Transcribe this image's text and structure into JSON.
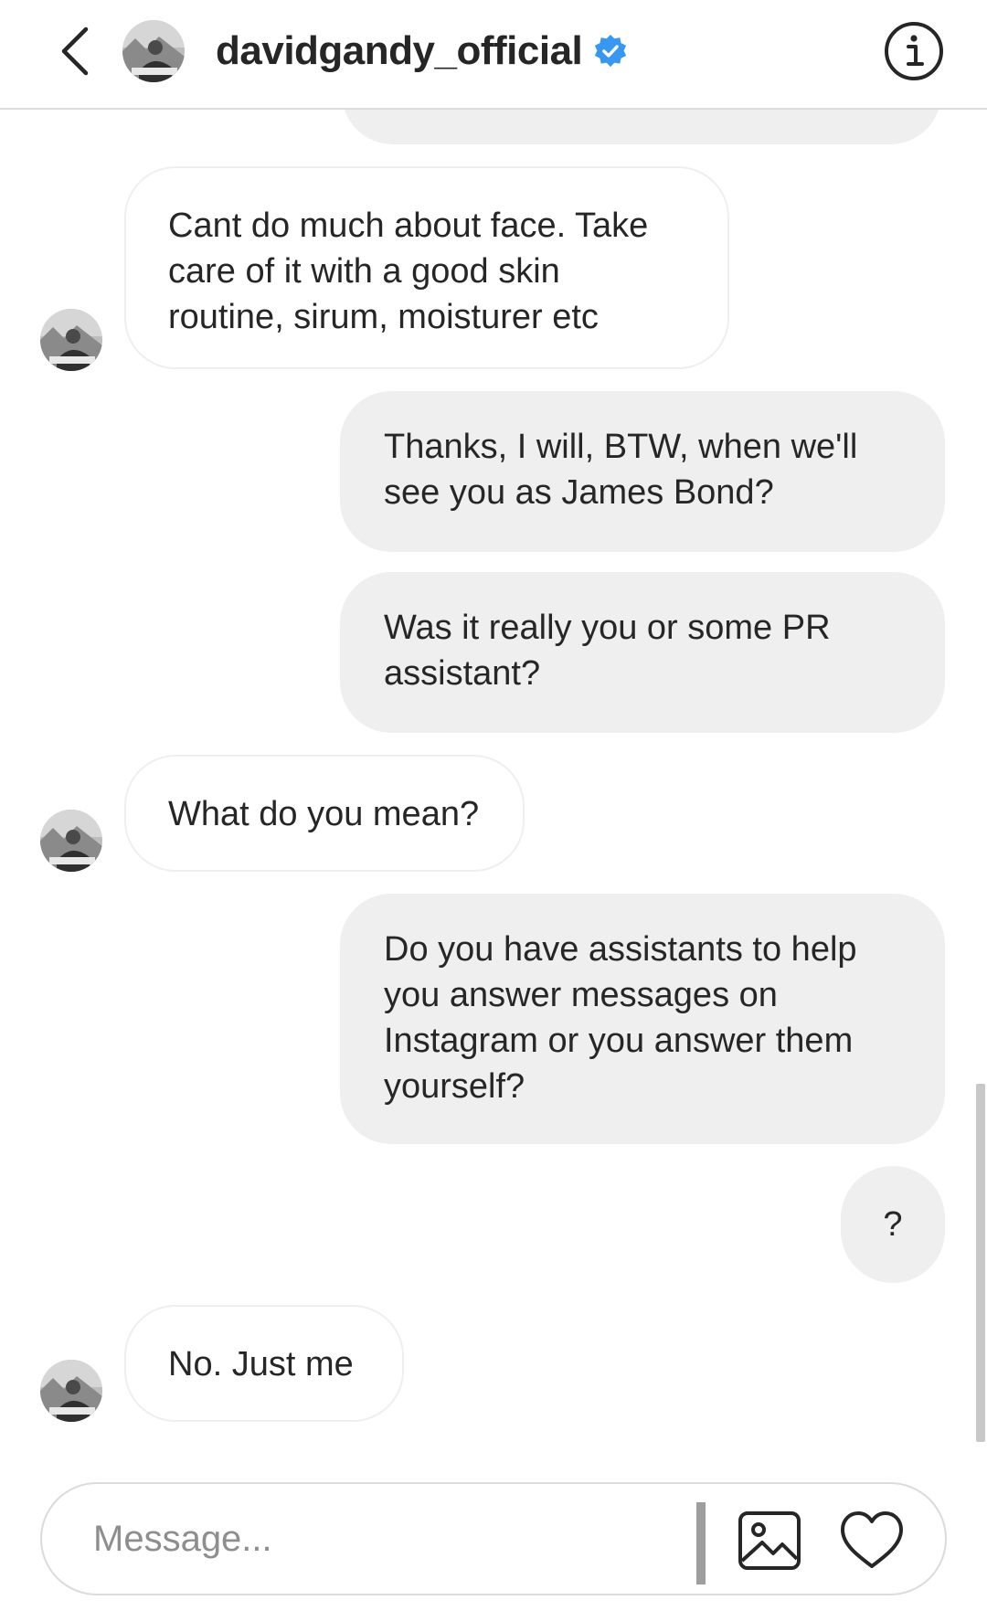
{
  "header": {
    "username": "davidgandy_official",
    "verified": true,
    "icons": {
      "back": "chevron-left-icon",
      "verified": "verified-badge-icon",
      "info": "info-icon"
    }
  },
  "colors": {
    "verified_blue": "#3897f0",
    "outgoing_bubble": "#efefef",
    "incoming_bubble_border": "#efefef",
    "text": "#262626",
    "placeholder": "#8e8e8e"
  },
  "messages": [
    {
      "direction": "in",
      "text": "Cant do much about face. Take care of it with a good skin routine, sirum, moisturer etc"
    },
    {
      "direction": "out",
      "text": "Thanks, I will, BTW, when we'll see you as James Bond?"
    },
    {
      "direction": "out",
      "text": "Was it really you or some PR assistant?"
    },
    {
      "direction": "in",
      "text": "What do you mean?"
    },
    {
      "direction": "out",
      "text": "Do you have assistants to help you answer messages on Instagram or you answer them yourself?"
    },
    {
      "direction": "out",
      "text": "?"
    },
    {
      "direction": "in",
      "text": "No. Just me"
    }
  ],
  "composer": {
    "placeholder": "Message...",
    "value": "",
    "icons": {
      "gallery": "image-gallery-icon",
      "like": "heart-icon"
    }
  }
}
